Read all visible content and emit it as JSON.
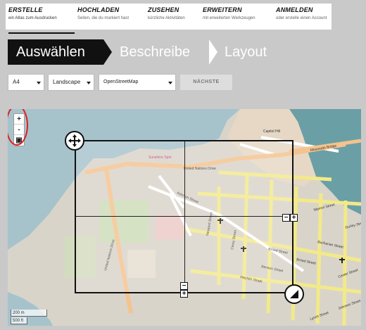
{
  "nav": {
    "items": [
      {
        "title": "ERSTELLE",
        "sub": "ein Atlas zum Ausdrucken"
      },
      {
        "title": "HOCHLADEN",
        "sub": "Seiten, die du markiert hast"
      },
      {
        "title": "ZUSEHEN",
        "sub": "kürzliche Aktivitäten"
      },
      {
        "title": "ERWEITERN",
        "sub": "mit erweiterten Werkzeugen"
      },
      {
        "title": "ANMELDEN",
        "sub": "oder erstelle einen Account"
      }
    ]
  },
  "steps": {
    "active": "Auswählen",
    "second": "Beschreibe",
    "third": "Layout"
  },
  "controls": {
    "paper": "A4",
    "orientation": "Landscape",
    "provider": "OpenStreetMap",
    "next": "NÄCHSTE"
  },
  "map": {
    "zoom_in": "+",
    "zoom_out": "-",
    "fit": "▣",
    "scale_metric": "200 m",
    "scale_imperial": "500 ft",
    "labels": {
      "un_drive_top": "United Nations Drive",
      "un_drive_left": "United Nations Drive",
      "ashmun": "Ashmun Street",
      "broad": "Broad Street",
      "broad2": "Broad Street",
      "benson": "Benson Street",
      "carey": "Carey Street",
      "newport": "Newport Street",
      "mechlin": "Mechlin Street",
      "buchanan": "Buchanan Street",
      "warren": "Warren Street",
      "capitol": "Capitol Hill",
      "mesurado": "Mesurado Bridge",
      "gurley": "Gurley Street",
      "lynch": "Lynch Street",
      "center": "Center Street",
      "johnson": "Johnson Street",
      "sunshine": "Sunshine Spot"
    }
  }
}
